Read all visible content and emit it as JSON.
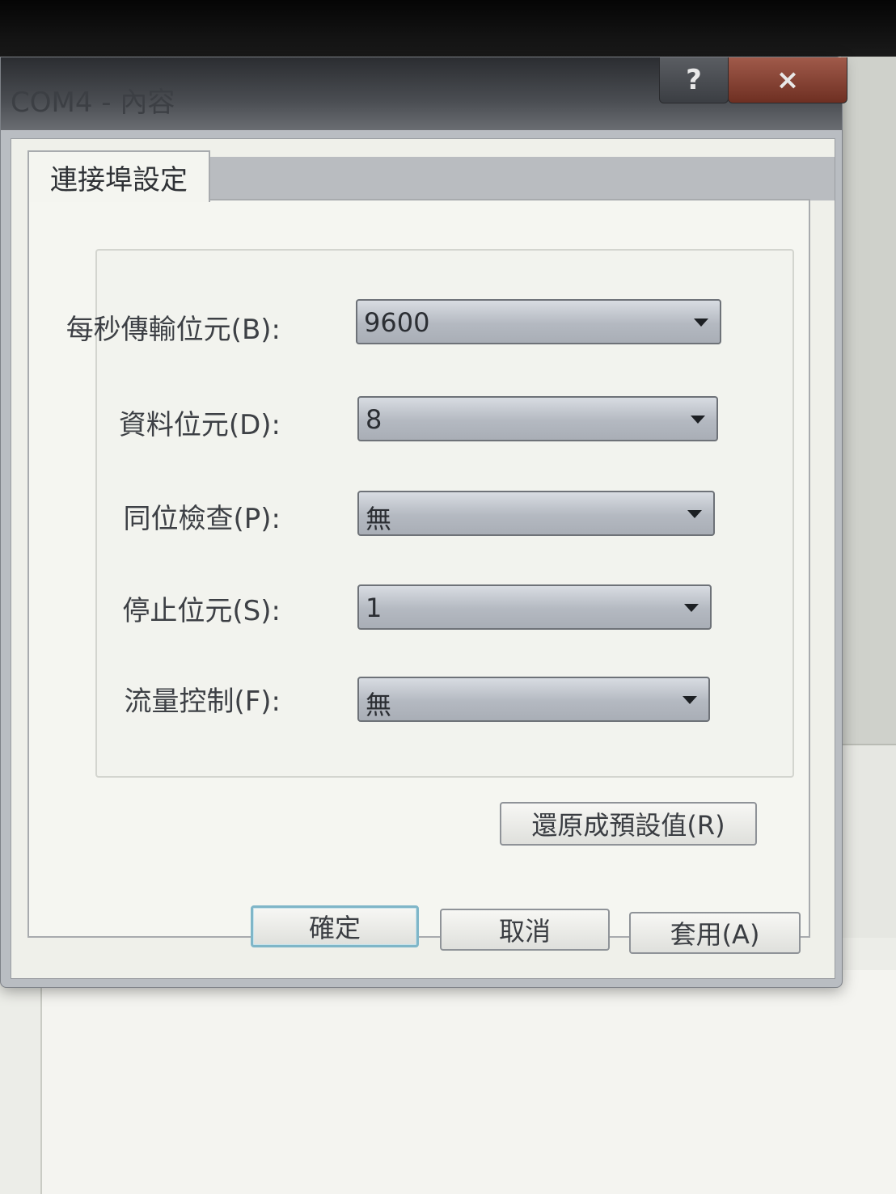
{
  "window": {
    "title": "COM4 - 內容",
    "help_label": "?",
    "close_label": "×"
  },
  "tabs": [
    {
      "label": "連接埠設定",
      "selected": true
    }
  ],
  "settings": {
    "fields": [
      {
        "label": "每秒傳輸位元(B):",
        "value": "9600"
      },
      {
        "label": "資料位元(D):",
        "value": "8"
      },
      {
        "label": "同位檢查(P):",
        "value": "無"
      },
      {
        "label": "停止位元(S):",
        "value": "1"
      },
      {
        "label": "流量控制(F):",
        "value": "無"
      }
    ],
    "restore_label": "還原成預設值(R)"
  },
  "footer": {
    "ok_label": "確定",
    "cancel_label": "取消",
    "apply_label": "套用(A)"
  },
  "colors": {
    "titlebar": "#3b3e43",
    "close_button": "#8a4535",
    "default_button_border": "#7fb6c8"
  }
}
